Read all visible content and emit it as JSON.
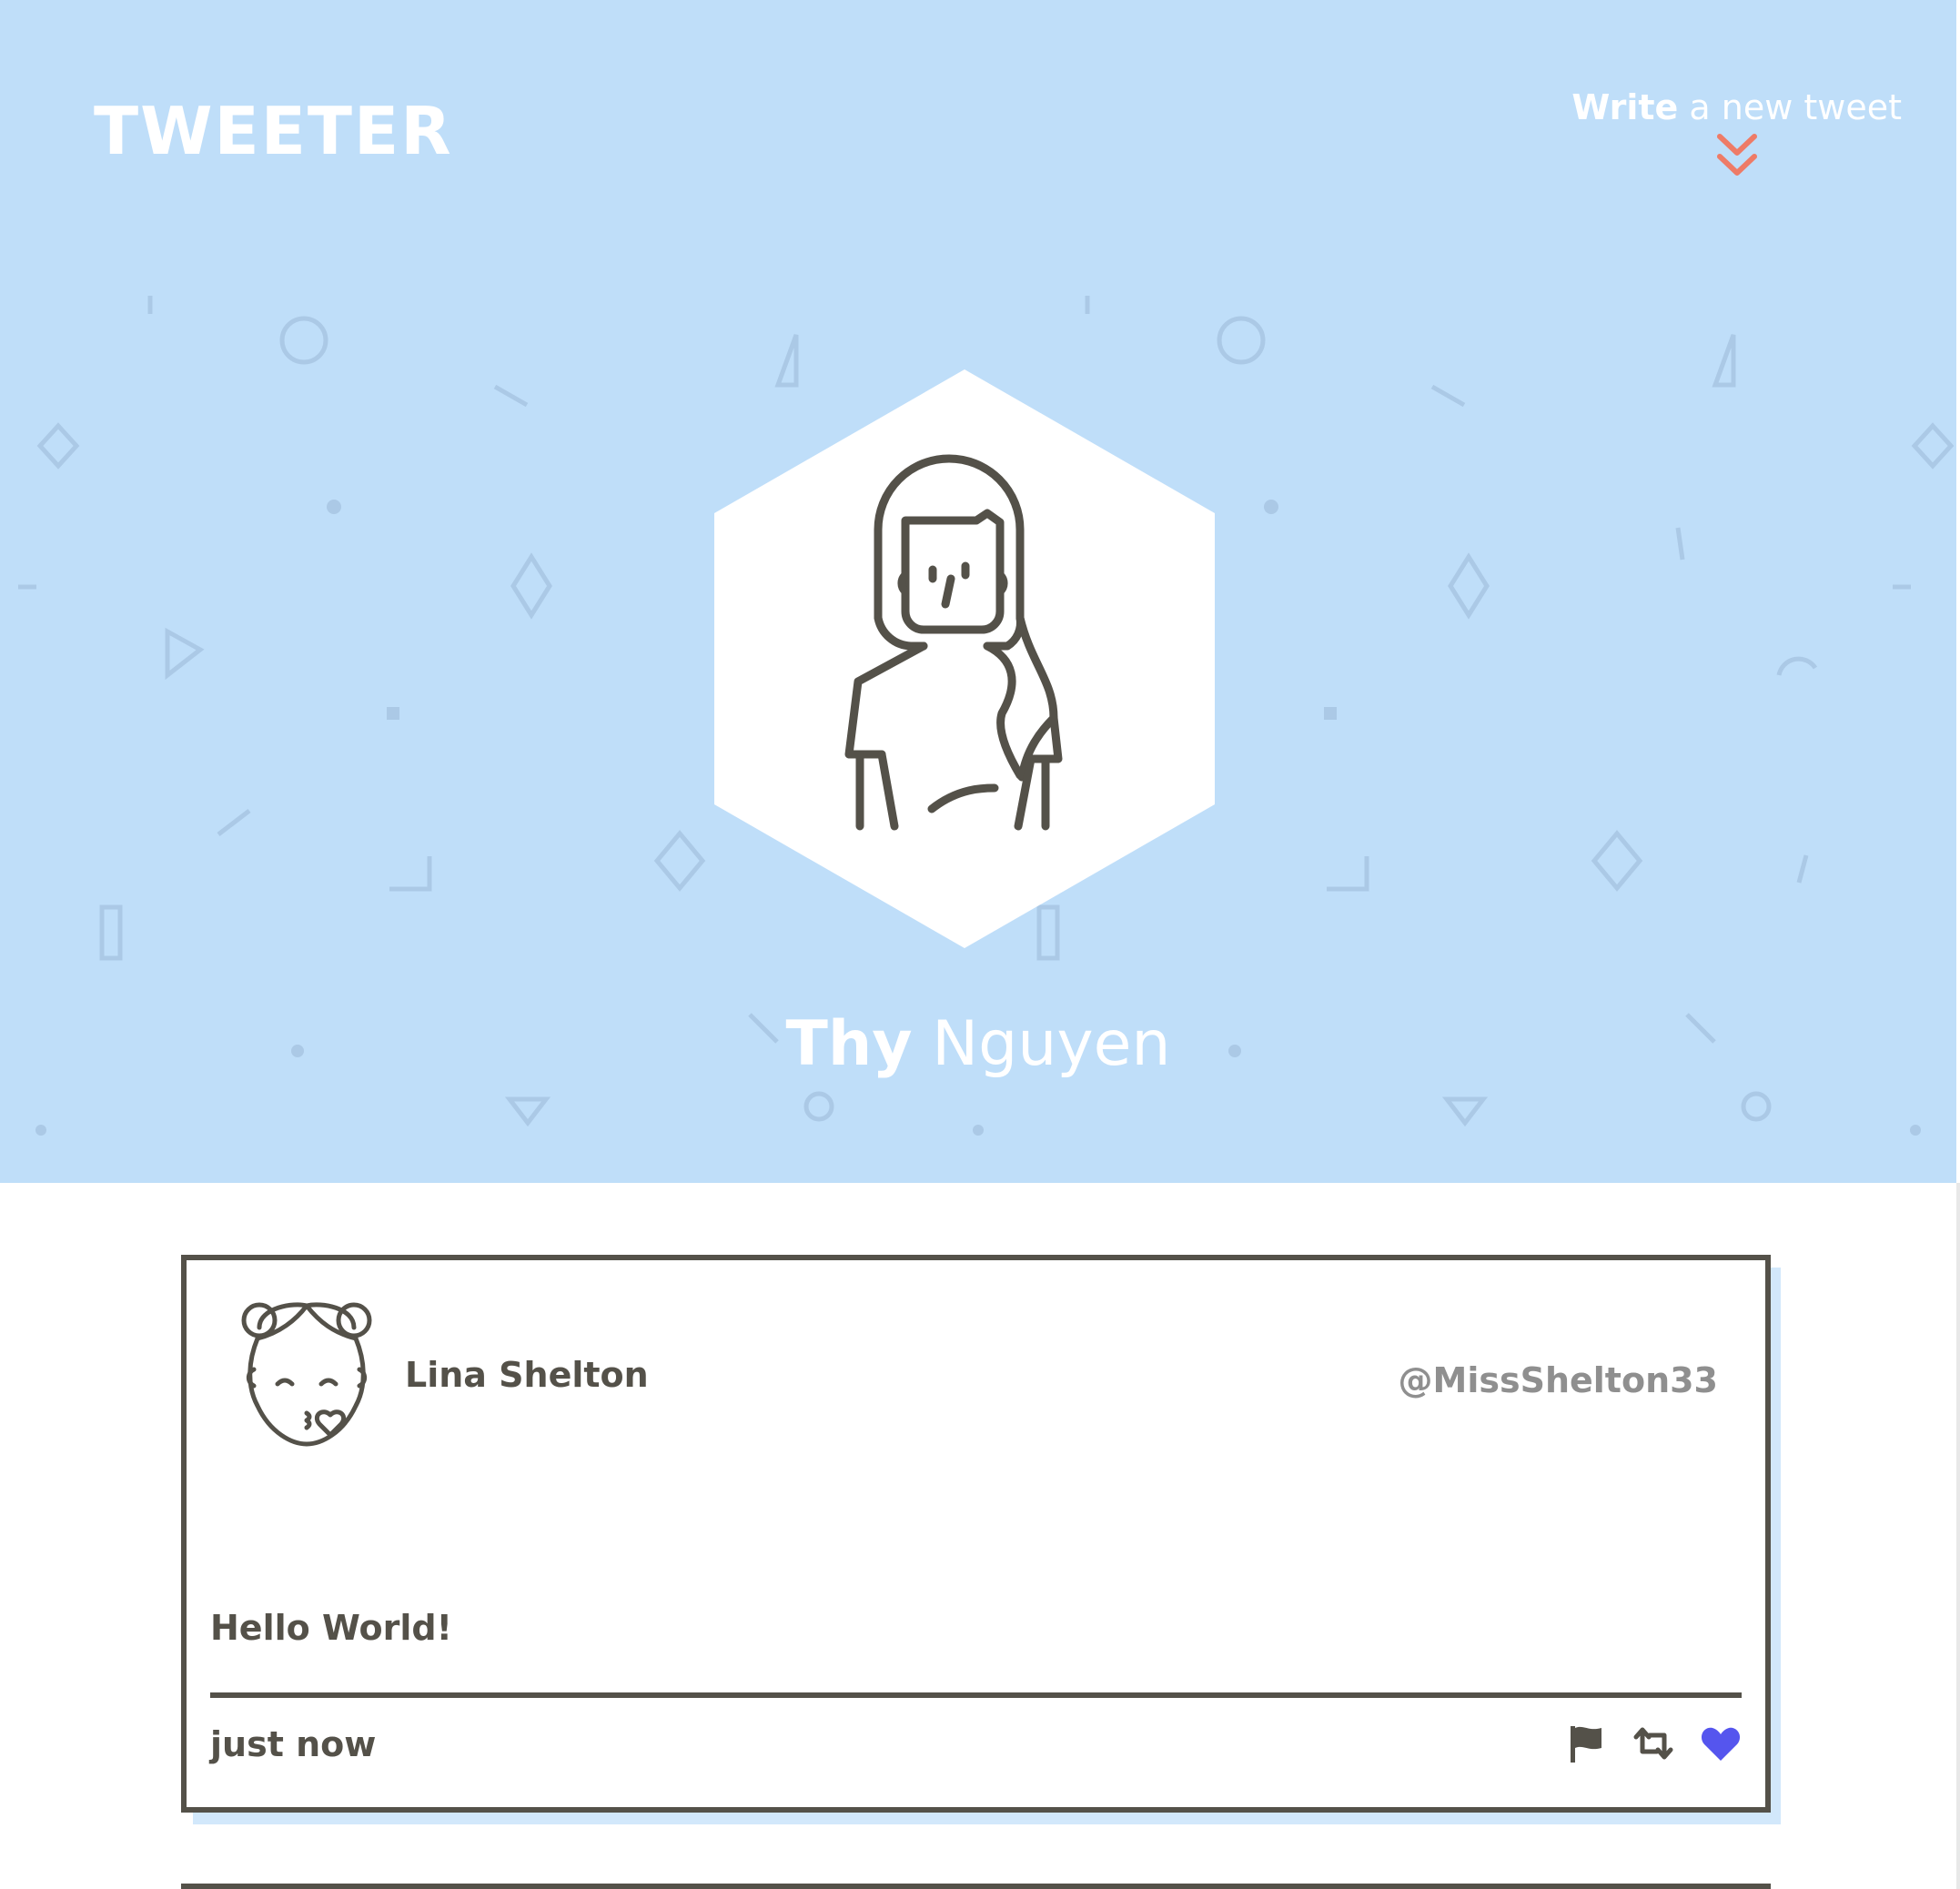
{
  "nav": {
    "brand": "TWEETER",
    "compose": {
      "strong": "Write",
      "rest": " a new tweet",
      "icon": "double-chevron-down-icon",
      "icon_color": "#ee7b67"
    }
  },
  "profile": {
    "first_name": "Thy",
    "last_name": " Nguyen",
    "avatar_icon": "woman-avatar-icon"
  },
  "tweets": [
    {
      "name": "Lina Shelton",
      "handle": "@MissShelton33",
      "content": "Hello World!",
      "time": "just now",
      "avatar_icon": "girl-kiss-avatar-icon",
      "actions": [
        {
          "icon": "flag-icon",
          "color": "#545149"
        },
        {
          "icon": "retweet-icon",
          "color": "#545149"
        },
        {
          "icon": "heart-icon",
          "color": "#5555ee"
        }
      ]
    }
  ],
  "colors": {
    "header_bg": "#bfdef9",
    "ink": "#545149",
    "handle": "#8f8f8f",
    "accent": "#ee7b67",
    "like": "#5555ee"
  }
}
